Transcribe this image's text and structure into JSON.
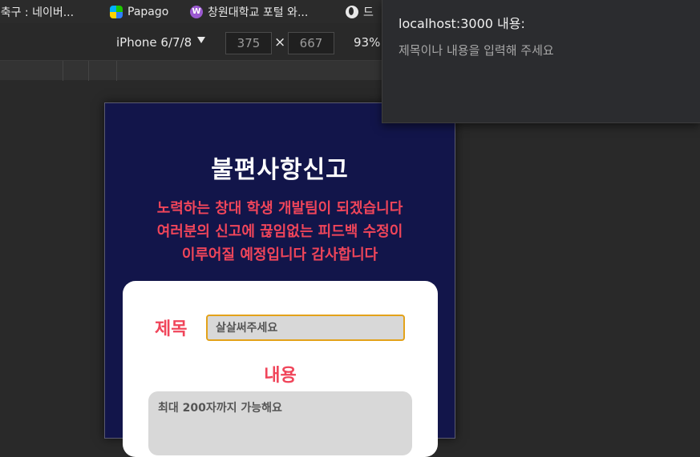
{
  "bookmarks": [
    {
      "label": "|축구 : 네이버...",
      "icon": "none"
    },
    {
      "label": "Papago",
      "icon": "papago-icon"
    },
    {
      "label": "창원대학교 포털 와...",
      "icon": "wiki-icon"
    },
    {
      "label": "드",
      "icon": "globe-icon"
    }
  ],
  "devtools": {
    "device": "iPhone 6/7/8",
    "width": "375",
    "times": "×",
    "height": "667",
    "zoom": "93%"
  },
  "page": {
    "title": "불편사항신고",
    "subtitle_lines": [
      "노력하는 창대 학생 개발팀이 되겠습니다",
      "여러분의 신고에 끊임없는 피드백 수정이",
      "이루어질 예정입니다 감사합니다"
    ],
    "form": {
      "title_label": "제목",
      "title_placeholder": "살살써주세요",
      "content_label": "내용",
      "content_placeholder": "최대 200자까지 가능해요"
    }
  },
  "popup": {
    "title": "localhost:3000 내용:",
    "message": "제목이나 내용을 입력해 주세요"
  },
  "colors": {
    "device_bg": "#12154a",
    "accent_red": "#f0455a",
    "input_focus": "#e3a21a"
  }
}
